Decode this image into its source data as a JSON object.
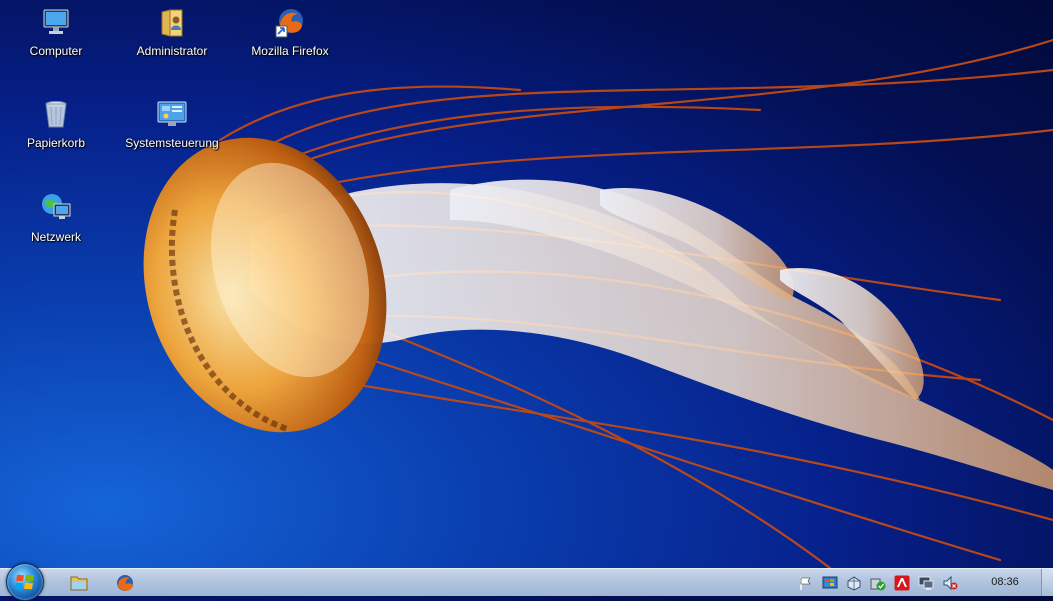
{
  "desktop": {
    "icons": [
      {
        "label": "Computer",
        "icon": "computer-icon"
      },
      {
        "label": "Administrator",
        "icon": "user-folder-icon"
      },
      {
        "label": "Mozilla Firefox",
        "icon": "firefox-icon"
      },
      {
        "label": "Papierkorb",
        "icon": "recycle-bin-icon"
      },
      {
        "label": "Systemsteuerung",
        "icon": "control-panel-icon"
      },
      {
        "label": "Netzwerk",
        "icon": "network-icon"
      }
    ]
  },
  "taskbar": {
    "pinned": [
      "explorer-icon",
      "firefox-icon"
    ],
    "tray": [
      "action-center-flag-icon",
      "windows-update-icon",
      "network-tray-icon",
      "security-shield-icon",
      "antivirus-umbrella-icon",
      "display-icon",
      "speaker-muted-icon"
    ],
    "clock": "08:36"
  },
  "colors": {
    "wallpaper_blue": "#06208a",
    "jellyfish_orange": "#e8821a",
    "taskbar": "#b1c4df"
  }
}
